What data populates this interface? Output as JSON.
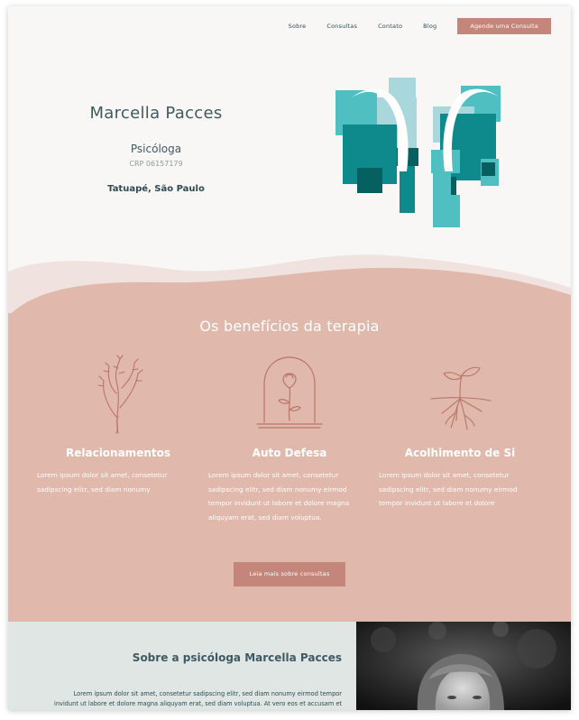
{
  "nav": {
    "items": [
      "Sobre",
      "Consultas",
      "Contato",
      "Blog"
    ],
    "cta_label": "Agende uma Consulta"
  },
  "hero": {
    "name": "Marcella Pacces",
    "role": "Psicóloga",
    "crp": "CRP 06157179",
    "location": "Tatuapé, São Paulo"
  },
  "benefits": {
    "title": "Os benefícios da terapia",
    "columns": [
      {
        "icon": "branch-plant-icon",
        "title": "Relacionamentos",
        "text": "Lorem ipsum dolor sit amet, consetetur sadipscing elitr, sed diam nonumy"
      },
      {
        "icon": "rose-under-dome-icon",
        "title": "Auto Defesa",
        "text": "Lorem ipsum dolor sit amet, consetetur sadipscing elitr, sed diam nonumy eirmod tempor invidunt ut labore et dolore magna aliquyam erat, sed diam voluptua."
      },
      {
        "icon": "sprout-roots-icon",
        "title": "Acolhimento de Si",
        "text": "Lorem ipsum dolor sit amet, consetetur sadipscing elitr, sed diam nonumy eirmod tempor invidunt ut labore et dolore"
      }
    ],
    "button_label": "Leia mais sobre consultas"
  },
  "about": {
    "title": "Sobre a psicóloga Marcella Pacces",
    "text": "Lorem ipsum dolor sit amet, consetetur sadipscing elitr, sed diam nonumy eirmod tempor invidunt ut labore et dolore magna aliquyam erat, sed diam voluptua. At vero eos et accusam et"
  },
  "colors": {
    "accent": "#c4867a",
    "benefits_bg": "#e1b8ac",
    "about_bg": "#dfe6e4",
    "teal": "#0f8a8c",
    "text": "#3f5a60"
  }
}
